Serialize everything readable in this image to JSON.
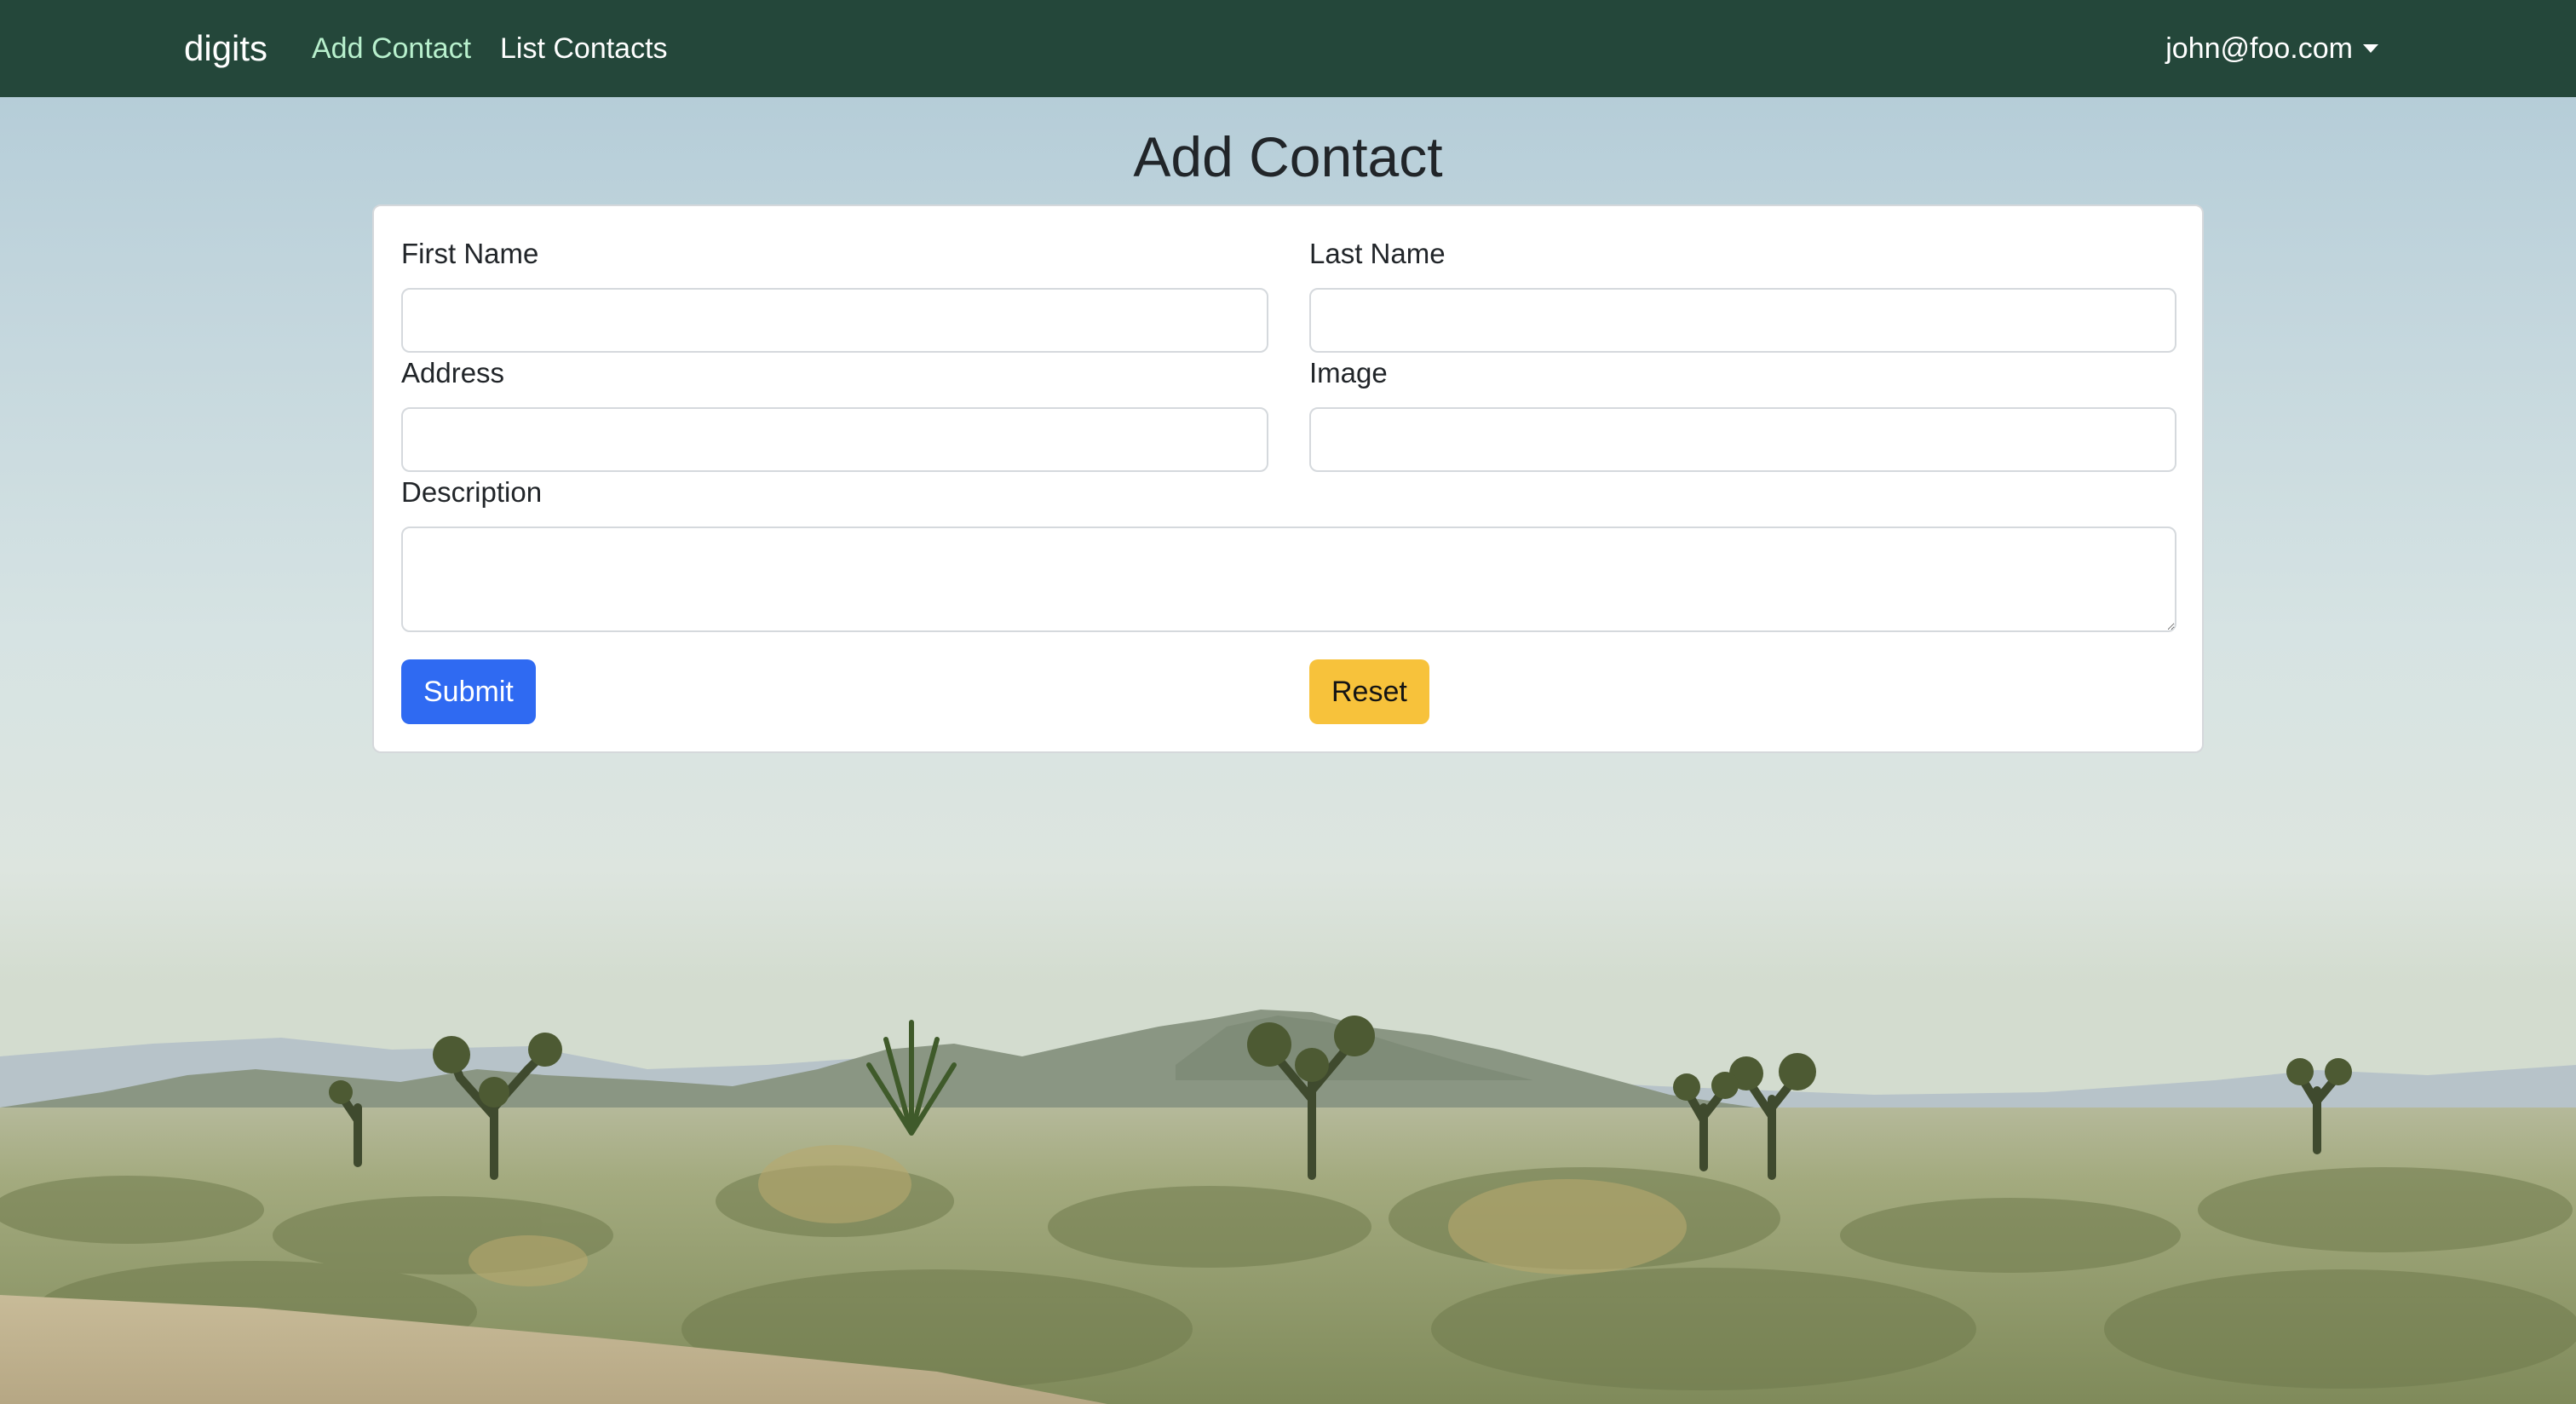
{
  "navbar": {
    "brand": "digits",
    "links": [
      {
        "label": "Add Contact",
        "active": true
      },
      {
        "label": "List Contacts",
        "active": false
      }
    ],
    "user": "john@foo.com"
  },
  "page": {
    "title": "Add Contact"
  },
  "form": {
    "first_name": {
      "label": "First Name",
      "value": ""
    },
    "last_name": {
      "label": "Last Name",
      "value": ""
    },
    "address": {
      "label": "Address",
      "value": ""
    },
    "image": {
      "label": "Image",
      "value": ""
    },
    "description": {
      "label": "Description",
      "value": ""
    },
    "submit_label": "Submit",
    "reset_label": "Reset"
  },
  "colors": {
    "navbar_bg": "#24473a",
    "active_link": "#b8f0cd",
    "primary_button": "#2f6af2",
    "warning_button": "#f7c23b"
  }
}
